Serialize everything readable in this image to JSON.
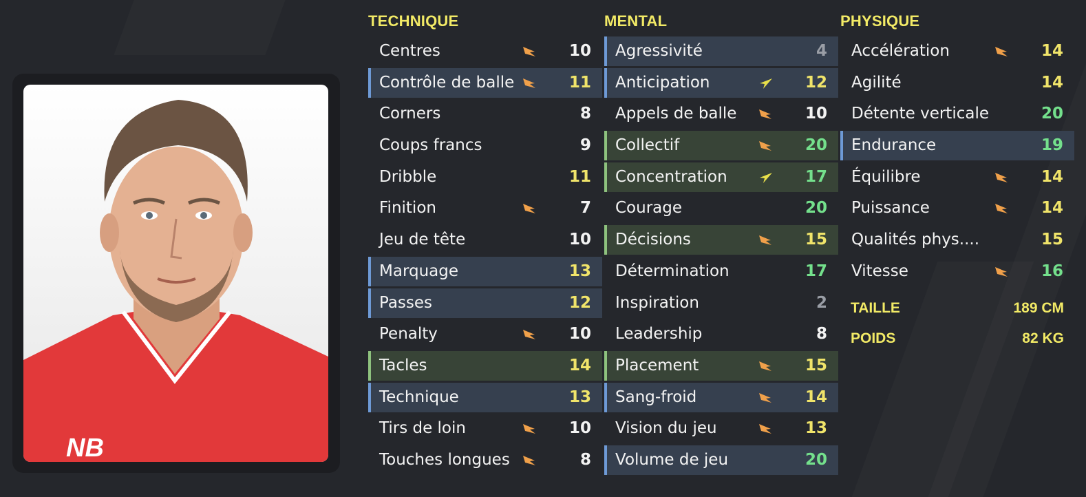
{
  "colors": {
    "header": "#f2ea66",
    "arrow_up": "#f0a04a",
    "arrow_growth": "#e8e04a",
    "value_white": "#f3f3f3",
    "value_yellow": "#f0e46a",
    "value_green": "#74e08c",
    "value_grey": "#9a9ea6",
    "highlight_blue": "#6e9ad6",
    "highlight_green": "#8ec27e"
  },
  "technique": {
    "title": "TECHNIQUE",
    "attributes": [
      {
        "label": "Centres",
        "value": "10",
        "color": "white",
        "arrow": "up",
        "highlight": "none"
      },
      {
        "label": "Contrôle de balle",
        "value": "11",
        "color": "yellow",
        "arrow": "up",
        "highlight": "blue"
      },
      {
        "label": "Corners",
        "value": "8",
        "color": "white",
        "arrow": "none",
        "highlight": "none"
      },
      {
        "label": "Coups francs",
        "value": "9",
        "color": "white",
        "arrow": "none",
        "highlight": "none"
      },
      {
        "label": "Dribble",
        "value": "11",
        "color": "yellow",
        "arrow": "none",
        "highlight": "none"
      },
      {
        "label": "Finition",
        "value": "7",
        "color": "white",
        "arrow": "up",
        "highlight": "none"
      },
      {
        "label": "Jeu de tête",
        "value": "10",
        "color": "white",
        "arrow": "none",
        "highlight": "none"
      },
      {
        "label": "Marquage",
        "value": "13",
        "color": "yellow",
        "arrow": "none",
        "highlight": "blue"
      },
      {
        "label": "Passes",
        "value": "12",
        "color": "yellow",
        "arrow": "none",
        "highlight": "blue"
      },
      {
        "label": "Penalty",
        "value": "10",
        "color": "white",
        "arrow": "up",
        "highlight": "none"
      },
      {
        "label": "Tacles",
        "value": "14",
        "color": "yellow",
        "arrow": "none",
        "highlight": "green"
      },
      {
        "label": "Technique",
        "value": "13",
        "color": "yellow",
        "arrow": "none",
        "highlight": "blue"
      },
      {
        "label": "Tirs de loin",
        "value": "10",
        "color": "white",
        "arrow": "up",
        "highlight": "none"
      },
      {
        "label": "Touches longues",
        "value": "8",
        "color": "white",
        "arrow": "up",
        "highlight": "none"
      }
    ]
  },
  "mental": {
    "title": "MENTAL",
    "attributes": [
      {
        "label": "Agressivité",
        "value": "4",
        "color": "grey",
        "arrow": "none",
        "highlight": "blue"
      },
      {
        "label": "Anticipation",
        "value": "12",
        "color": "yellow",
        "arrow": "growth",
        "highlight": "blue"
      },
      {
        "label": "Appels de balle",
        "value": "10",
        "color": "white",
        "arrow": "up",
        "highlight": "none"
      },
      {
        "label": "Collectif",
        "value": "20",
        "color": "green",
        "arrow": "up",
        "highlight": "green"
      },
      {
        "label": "Concentration",
        "value": "17",
        "color": "green",
        "arrow": "growth",
        "highlight": "green"
      },
      {
        "label": "Courage",
        "value": "20",
        "color": "green",
        "arrow": "none",
        "highlight": "none"
      },
      {
        "label": "Décisions",
        "value": "15",
        "color": "yellow",
        "arrow": "up",
        "highlight": "green"
      },
      {
        "label": "Détermination",
        "value": "17",
        "color": "green",
        "arrow": "none",
        "highlight": "none"
      },
      {
        "label": "Inspiration",
        "value": "2",
        "color": "grey",
        "arrow": "none",
        "highlight": "none"
      },
      {
        "label": "Leadership",
        "value": "8",
        "color": "white",
        "arrow": "none",
        "highlight": "none"
      },
      {
        "label": "Placement",
        "value": "15",
        "color": "yellow",
        "arrow": "up",
        "highlight": "green"
      },
      {
        "label": "Sang-froid",
        "value": "14",
        "color": "yellow",
        "arrow": "up",
        "highlight": "blue"
      },
      {
        "label": "Vision du jeu",
        "value": "13",
        "color": "yellow",
        "arrow": "up",
        "highlight": "none"
      },
      {
        "label": "Volume de jeu",
        "value": "20",
        "color": "green",
        "arrow": "none",
        "highlight": "blue"
      }
    ]
  },
  "physique": {
    "title": "PHYSIQUE",
    "attributes": [
      {
        "label": "Accélération",
        "value": "14",
        "color": "yellow",
        "arrow": "up",
        "highlight": "none"
      },
      {
        "label": "Agilité",
        "value": "14",
        "color": "yellow",
        "arrow": "none",
        "highlight": "none"
      },
      {
        "label": "Détente verticale",
        "value": "20",
        "color": "green",
        "arrow": "none",
        "highlight": "none"
      },
      {
        "label": "Endurance",
        "value": "19",
        "color": "green",
        "arrow": "none",
        "highlight": "blue"
      },
      {
        "label": "Équilibre",
        "value": "14",
        "color": "yellow",
        "arrow": "up",
        "highlight": "none"
      },
      {
        "label": "Puissance",
        "value": "14",
        "color": "yellow",
        "arrow": "up",
        "highlight": "none"
      },
      {
        "label": "Qualités phys....",
        "value": "15",
        "color": "yellow",
        "arrow": "none",
        "highlight": "none"
      },
      {
        "label": "Vitesse",
        "value": "16",
        "color": "green",
        "arrow": "up",
        "highlight": "none"
      }
    ]
  },
  "info": {
    "height_label": "TAILLE",
    "height_value": "189 CM",
    "weight_label": "POIDS",
    "weight_value": "82 KG"
  },
  "player_photo": {
    "icon": "player-portrait-icon",
    "kit_logo_text": "NB"
  }
}
